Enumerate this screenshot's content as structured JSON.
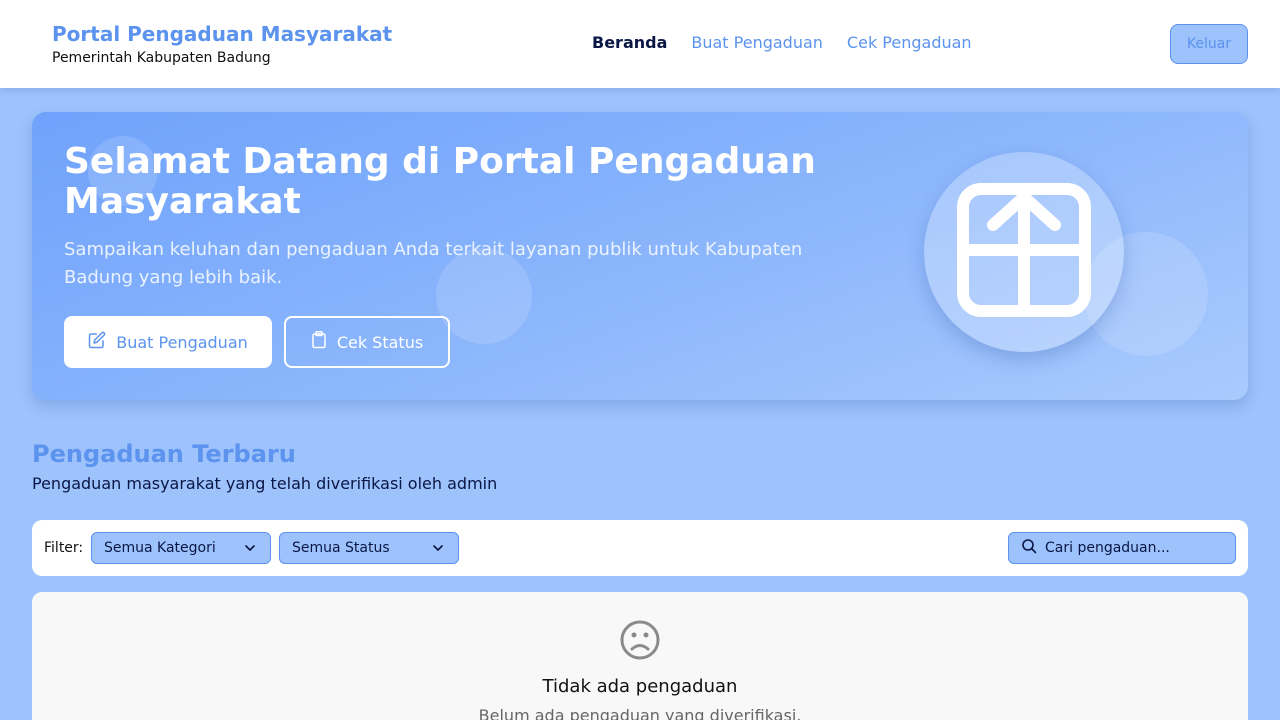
{
  "header": {
    "brand_title": "Portal Pengaduan Masyarakat",
    "brand_subtitle": "Pemerintah Kabupaten Badung",
    "nav": [
      {
        "label": "Beranda",
        "active": true
      },
      {
        "label": "Buat Pengaduan",
        "active": false
      },
      {
        "label": "Cek Pengaduan",
        "active": false
      }
    ],
    "logout_label": "Keluar"
  },
  "hero": {
    "title": "Selamat Datang di Portal Pengaduan Masyarakat",
    "description": "Sampaikan keluhan dan pengaduan Anda terkait layanan publik untuk Kabupaten Badung yang lebih baik.",
    "primary_button": "Buat Pengaduan",
    "primary_icon": "edit-icon",
    "secondary_button": "Cek Status",
    "secondary_icon": "clipboard-icon",
    "art_icon": "package-icon"
  },
  "section": {
    "title": "Pengaduan Terbaru",
    "subtitle": "Pengaduan masyarakat yang telah diverifikasi oleh admin"
  },
  "filters": {
    "label": "Filter:",
    "category_selected": "Semua Kategori",
    "status_selected": "Semua Status",
    "search_placeholder": "Cari pengaduan..."
  },
  "empty_state": {
    "icon": "sad-face-icon",
    "title": "Tidak ada pengaduan",
    "subtitle": "Belum ada pengaduan yang diverifikasi."
  },
  "colors": {
    "accent": "#5b93ee",
    "background": "#9dc2fc",
    "nav_active": "#0a1744"
  }
}
